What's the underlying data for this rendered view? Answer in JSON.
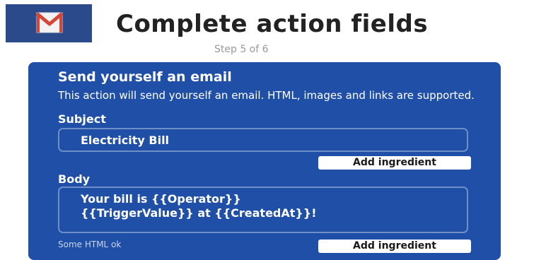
{
  "header": {
    "service_icon": "gmail-envelope-icon",
    "title": "Complete action fields",
    "step": "Step 5 of 6"
  },
  "action": {
    "title": "Send yourself an email",
    "description": "This action will send yourself an email. HTML, images and links are supported.",
    "subject": {
      "label": "Subject",
      "value": "Electricity Bill",
      "add_ingredient_label": "Add ingredient"
    },
    "body": {
      "label": "Body",
      "line1": "Your bill is {{Operator}}",
      "line2": "{{TriggerValue}} at {{CreatedAt}}!",
      "helper": "Some HTML ok",
      "add_ingredient_label": "Add ingredient"
    }
  },
  "colors": {
    "card_background": "#1f4fa6",
    "icon_background": "#2a4a8c",
    "envelope_red": "#d44638"
  }
}
